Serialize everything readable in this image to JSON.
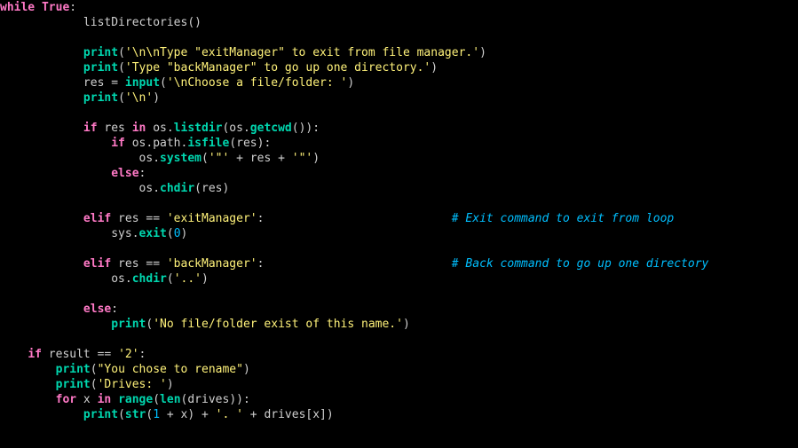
{
  "code": {
    "l1": {
      "kw_while": "while",
      "lit_true": "True",
      "colon": ":"
    },
    "l2": {
      "call": "listDirectories",
      "paren": "()"
    },
    "l3": {
      "func": "print",
      "open": "(",
      "str": "'\\n\\nType \"exitManager\" to exit from file manager.'",
      "close": ")"
    },
    "l4": {
      "func": "print",
      "open": "(",
      "str": "'Type \"backManager\" to go up one directory.'",
      "close": ")"
    },
    "l5": {
      "var": "res = ",
      "func": "input",
      "open": "(",
      "str": "'\\nChoose a file/folder: '",
      "close": ")"
    },
    "l6": {
      "func": "print",
      "open": "(",
      "str": "'\\n'",
      "close": ")"
    },
    "l7": {
      "kw_if": "if",
      "mid1": " res ",
      "kw_in": "in",
      "mid2": " os.",
      "f1": "listdir",
      "p1": "(os.",
      "f2": "getcwd",
      "p2": "()):"
    },
    "l8": {
      "kw_if": "if",
      "mid": " os.path.",
      "f": "isfile",
      "rest": "(res):"
    },
    "l9": {
      "pre": "os.",
      "f": "system",
      "open": "(",
      "s1": "'\"'",
      "mid": " + res + ",
      "s2": "'\"'",
      "close": ")"
    },
    "l10": {
      "kw": "else",
      "colon": ":"
    },
    "l11": {
      "pre": "os.",
      "f": "chdir",
      "rest": "(res)"
    },
    "l12": {
      "kw": "elif",
      "mid": " res == ",
      "str": "'exitManager'",
      "colon": ":",
      "pad": "                           ",
      "cmt": "# Exit command to exit from loop"
    },
    "l13": {
      "pre": "sys.",
      "f": "exit",
      "open": "(",
      "num": "0",
      "close": ")"
    },
    "l14": {
      "kw": "elif",
      "mid": " res == ",
      "str": "'backManager'",
      "colon": ":",
      "pad": "                           ",
      "cmt": "# Back command to go up one directory"
    },
    "l15": {
      "pre": "os.",
      "f": "chdir",
      "open": "(",
      "str": "'..'",
      "close": ")"
    },
    "l16": {
      "kw": "else",
      "colon": ":"
    },
    "l17": {
      "func": "print",
      "open": "(",
      "str": "'No file/folder exist of this name.'",
      "close": ")"
    },
    "l18": {
      "kw": "if",
      "mid": " result == ",
      "str": "'2'",
      "colon": ":"
    },
    "l19": {
      "func": "print",
      "open": "(",
      "str": "\"You chose to rename\"",
      "close": ")"
    },
    "l20": {
      "func": "print",
      "open": "(",
      "str": "'Drives: '",
      "close": ")"
    },
    "l21": {
      "kw_for": "for",
      "mid1": " x ",
      "kw_in": "in",
      "sp": " ",
      "f1": "range",
      "p1": "(",
      "f2": "len",
      "p2": "(drives)):"
    },
    "l22": {
      "func": "print",
      "open": "(",
      "f1": "str",
      "p1": "(",
      "n1": "1",
      "mid1": " + x) + ",
      "str": "'. '",
      "mid2": " + drives[x])"
    }
  }
}
